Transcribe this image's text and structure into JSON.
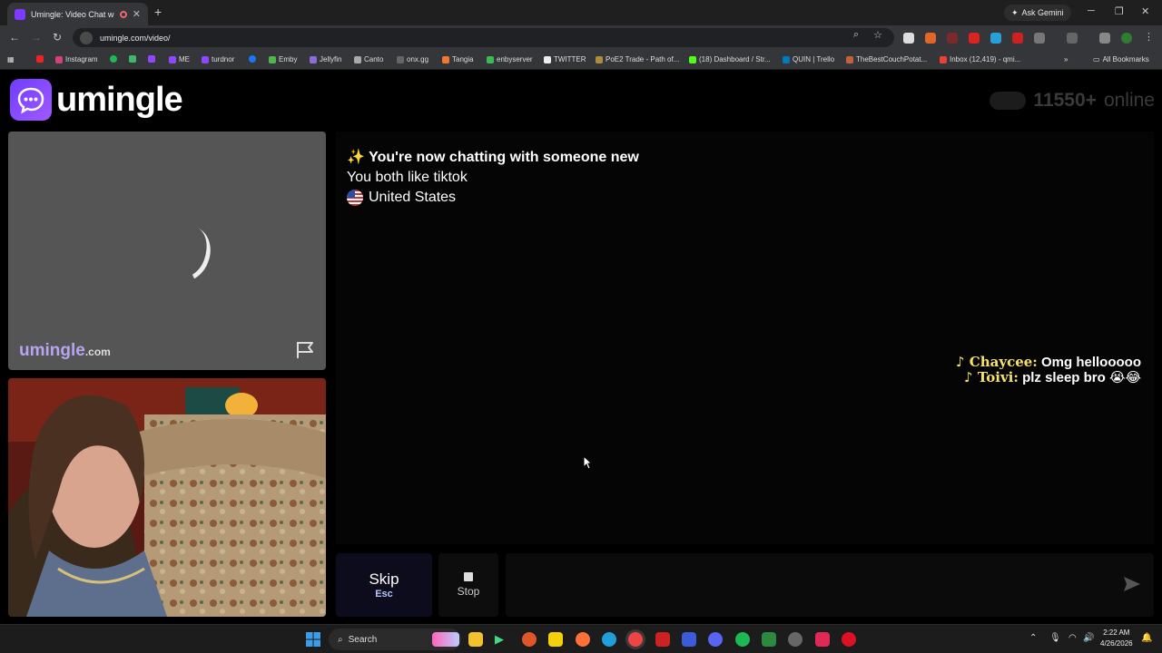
{
  "browser": {
    "tab_title": "Umingle: Video Chat with S",
    "address": "umingle.com/video/",
    "ask_gemini": "Ask Gemini",
    "bookmarks": [
      "Instagram",
      "ME",
      "turdnor",
      "Emby",
      "Jellyfin",
      "Canto",
      "onx.gg",
      "Tangia",
      "enbyserver",
      "TWITTER",
      "PoE2 Trade - Path of...",
      "(18) Dashboard / Str...",
      "QUIN | Trello",
      "TheBestCouchPotat...",
      "Inbox (12,419) - qmi..."
    ],
    "all_bookmarks": "All Bookmarks"
  },
  "header": {
    "logo_text": "umingle",
    "online_count": "11550+",
    "online_label": "online"
  },
  "stranger": {
    "watermark": "umingle",
    "watermark_suffix": ".com"
  },
  "chat": {
    "system_title": "✨ You're now chatting with someone new",
    "common_interest": "You both like tiktok",
    "country": "United States"
  },
  "overlay": {
    "messages": [
      {
        "name": "♪ Chaycee:",
        "text": " Omg hellooooo"
      },
      {
        "name": "♪ Toivi:",
        "text": " plz sleep bro 😭😂"
      }
    ]
  },
  "controls": {
    "skip_label": "Skip",
    "skip_key": "Esc",
    "stop_label": "Stop",
    "message_placeholder": ""
  },
  "taskbar": {
    "search_label": "Search",
    "time": "2:22 AM",
    "date": "4/26/2026"
  },
  "colors": {
    "brand": "#7b3cff",
    "overlay_name": "#f7e36b",
    "skip_key": "#b9c3ff"
  }
}
